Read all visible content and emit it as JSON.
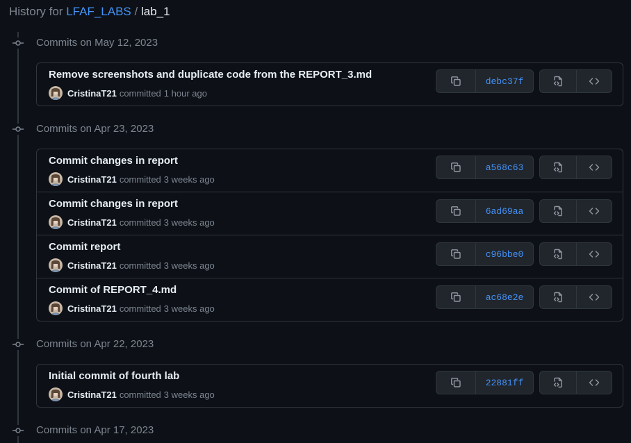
{
  "header": {
    "prefix": "History for",
    "repo": "LFAF_LABS",
    "separator": "/",
    "path": "lab_1"
  },
  "groups": [
    {
      "date": "Commits on May 12, 2023",
      "commits": [
        {
          "title": "Remove screenshots and duplicate code from the REPORT_3.md",
          "author": "CristinaT21",
          "action": "committed",
          "time": "1 hour ago",
          "sha": "debc37f"
        }
      ]
    },
    {
      "date": "Commits on Apr 23, 2023",
      "commits": [
        {
          "title": "Commit changes in report",
          "author": "CristinaT21",
          "action": "committed",
          "time": "3 weeks ago",
          "sha": "a568c63"
        },
        {
          "title": "Commit changes in report",
          "author": "CristinaT21",
          "action": "committed",
          "time": "3 weeks ago",
          "sha": "6ad69aa"
        },
        {
          "title": "Commit report",
          "author": "CristinaT21",
          "action": "committed",
          "time": "3 weeks ago",
          "sha": "c96bbe0"
        },
        {
          "title": "Commit of REPORT_4.md",
          "author": "CristinaT21",
          "action": "committed",
          "time": "3 weeks ago",
          "sha": "ac68e2e"
        }
      ]
    },
    {
      "date": "Commits on Apr 22, 2023",
      "commits": [
        {
          "title": "Initial commit of fourth lab",
          "author": "CristinaT21",
          "action": "committed",
          "time": "3 weeks ago",
          "sha": "22881ff"
        }
      ]
    },
    {
      "date": "Commits on Apr 17, 2023",
      "commits": []
    }
  ],
  "icons": {
    "timeline_node": "git-commit-icon",
    "copy": "copy-icon",
    "browse_files": "file-code-icon",
    "browse_repo": "code-icon"
  },
  "colors": {
    "background": "#0d1117",
    "border": "#30363d",
    "link": "#4493f8",
    "muted": "#7d8590",
    "text": "#e6edf3",
    "button": "#21262d"
  }
}
